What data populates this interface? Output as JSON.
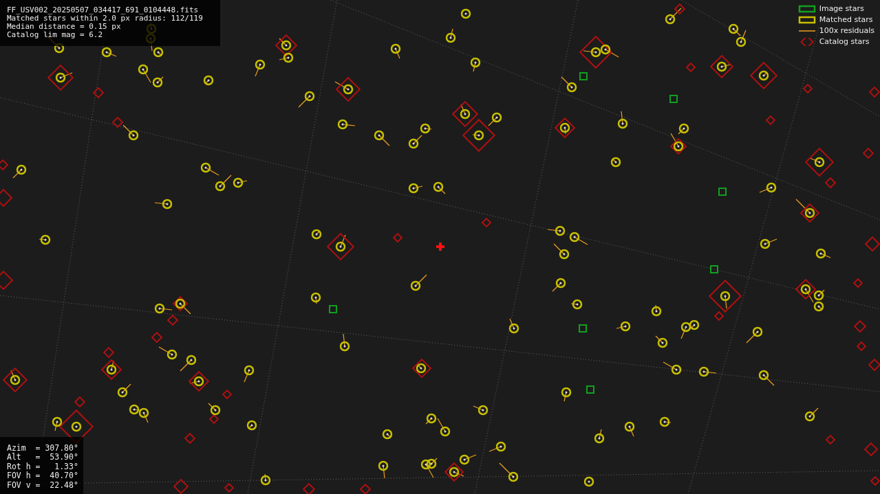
{
  "info": [
    "FF_USV002_20250507_034417_691_0104448.fits",
    "Matched stars within 2.0 px radius: 112/119",
    "Median distance = 0.15 px",
    "Catalog lim mag = 6.2"
  ],
  "legend": [
    {
      "kind": "image",
      "label": "Image stars"
    },
    {
      "kind": "matched",
      "label": "Matched stars"
    },
    {
      "kind": "residual",
      "label": "100x residuals"
    },
    {
      "kind": "catalog",
      "label": "Catalog stars"
    }
  ],
  "pointing": [
    "Azim  = 307.80°",
    "Alt   =  53.90°",
    "Rot h =   1.33°",
    "FOV h =  40.70°",
    "FOV v =  22.48°"
  ]
}
